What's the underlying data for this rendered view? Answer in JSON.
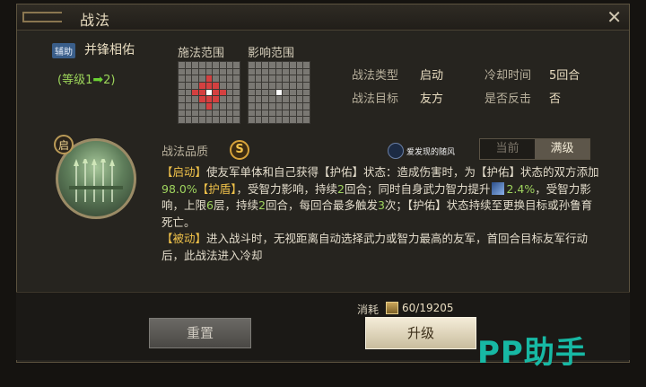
{
  "window": {
    "title": "战法"
  },
  "tactic": {
    "badge": "辅助",
    "name": "并锋相佑",
    "level_prefix": "(等级1",
    "level_arrow": "➡",
    "level_suffix": "2)",
    "start_badge": "启"
  },
  "ranges": {
    "cast_label": "施法范围",
    "effect_label": "影响范围"
  },
  "info": {
    "type_label": "战法类型",
    "type_value": "启动",
    "target_label": "战法目标",
    "target_value": "友方",
    "cooldown_label": "冷却时间",
    "cooldown_value": "5回合",
    "counter_label": "是否反击",
    "counter_value": "否"
  },
  "quality": {
    "label": "战法品质",
    "value": "S"
  },
  "watermark": {
    "text": "爱发现的随风"
  },
  "toggle": {
    "current": "当前",
    "max": "满级"
  },
  "description": {
    "p1_tag": "【启动】",
    "p1_a": "使友军单体和自己获得【护佑】状态：造成伤害时，为【护佑】状态的双方添加",
    "p1_pct": "98.0%",
    "p1_tag2": "【护盾】",
    "p1_b": "，受智力影响，持续",
    "p1_n1": "2",
    "p1_c": "回合；同时自身武力智力提升",
    "p1_pct2": "2.4%",
    "p1_d": "，受智力影响，上限",
    "p1_n2": "6",
    "p1_e": "层，持续",
    "p1_n3": "2",
    "p1_f": "回合，每回合最多触发",
    "p1_n4": "3",
    "p1_g": "次；【护佑】状态持续至更换目标或孙鲁育死亡。",
    "p2_tag": "【被动】",
    "p2_a": "进入战斗时，无视距离自动选择武力或智力最高的友军，首回合目标友军行动后，此战法进入冷却"
  },
  "cost": {
    "label": "消耗",
    "value": "60/19205"
  },
  "buttons": {
    "reset": "重置",
    "upgrade": "升级"
  },
  "branding": {
    "pp": "PP助手"
  }
}
